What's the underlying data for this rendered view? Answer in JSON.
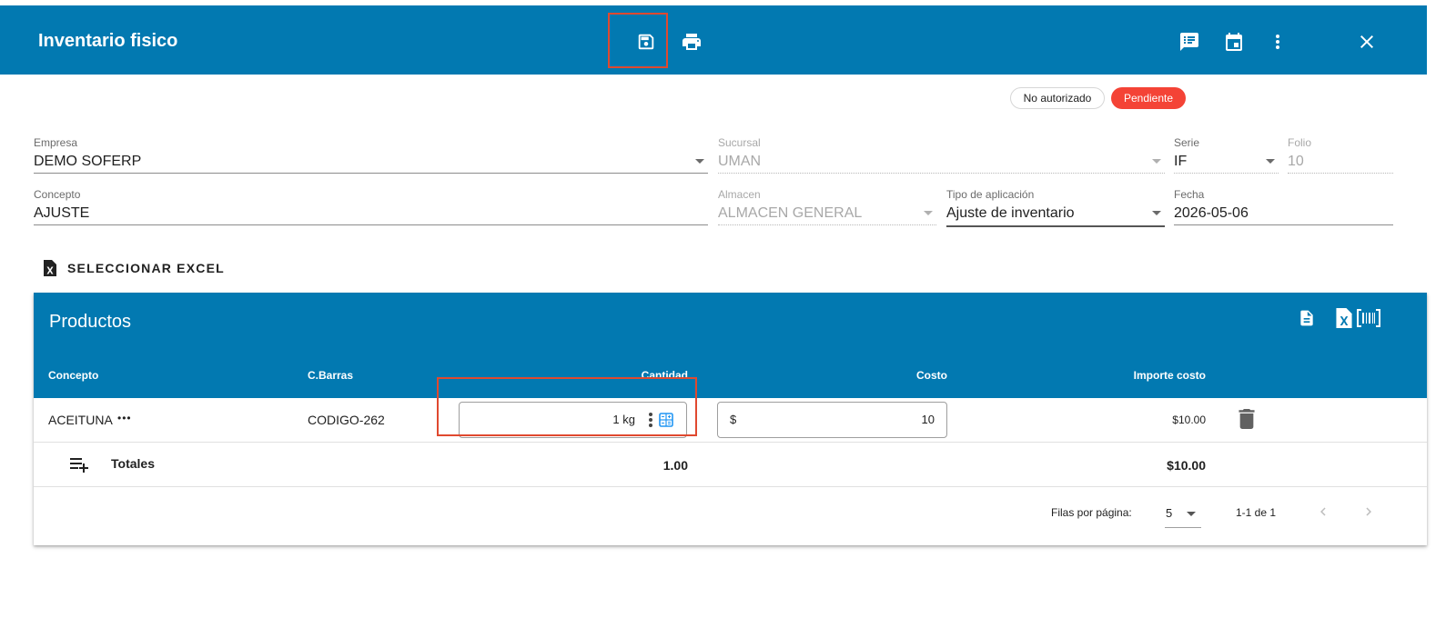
{
  "appbar": {
    "title": "Inventario fisico",
    "icons": [
      "save-icon",
      "print-icon",
      "comment-icon",
      "calendar-icon",
      "more-vert-icon",
      "close-icon"
    ],
    "background": "#0279b1"
  },
  "status": {
    "authorization": "No autorizado",
    "state": "Pendiente",
    "state_color": "#f44336"
  },
  "form": {
    "empresa": {
      "label": "Empresa",
      "value": "DEMO SOFERP"
    },
    "sucursal": {
      "label": "Sucursal",
      "value": "UMAN"
    },
    "serie": {
      "label": "Serie",
      "value": "IF"
    },
    "folio": {
      "label": "Folio",
      "value": "10"
    },
    "concepto": {
      "label": "Concepto",
      "value": "AJUSTE"
    },
    "almacen": {
      "label": "Almacen",
      "value": "ALMACEN GENERAL"
    },
    "tipo_aplicacion": {
      "label": "Tipo de aplicación",
      "value": "Ajuste de inventario"
    },
    "fecha": {
      "label": "Fecha",
      "value": "2026-05-06"
    }
  },
  "excel_button": {
    "label": "SELECCIONAR EXCEL",
    "icon": "excel-file-icon"
  },
  "products": {
    "title": "Productos",
    "header_icons": [
      "document-icon",
      "excel-icon",
      "barcode-icon"
    ],
    "columns": [
      "Concepto",
      "C.Barras",
      "Cantidad",
      "Costo",
      "Importe costo"
    ],
    "rows": [
      {
        "concepto": "ACEITUNA",
        "more": "•••",
        "barras": "CODIGO-262",
        "cantidad": "1 kg",
        "costo_prefix": "$",
        "costo": "10",
        "importe": "$10.00"
      }
    ],
    "totals": {
      "label": "Totales",
      "cantidad": "1.00",
      "importe": "$10.00"
    },
    "pagination": {
      "rows_per_page_label": "Filas por página:",
      "rows_per_page": "5",
      "range": "1-1 de 1"
    }
  }
}
